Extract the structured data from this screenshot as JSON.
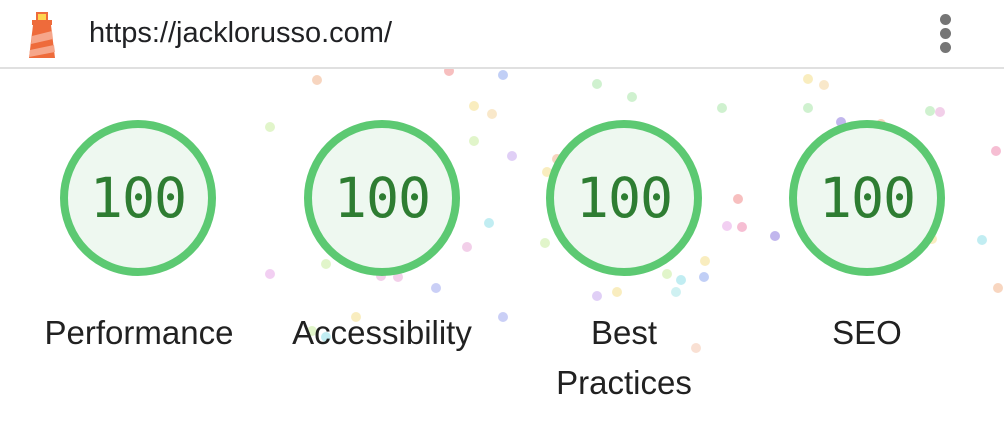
{
  "header": {
    "url": "https://jacklorusso.com/",
    "logo_icon": "lighthouse-icon",
    "menu_icon": "more-vert-icon"
  },
  "colors": {
    "pass_ring": "#5cc972",
    "pass_fill": "#eef8f0",
    "pass_text": "#2e7d32"
  },
  "categories": [
    {
      "label": "Performance",
      "score": "100"
    },
    {
      "label": "Accessibility",
      "score": "100"
    },
    {
      "label": "Best Practices",
      "score": "100"
    },
    {
      "label": "SEO",
      "score": "100"
    }
  ]
}
